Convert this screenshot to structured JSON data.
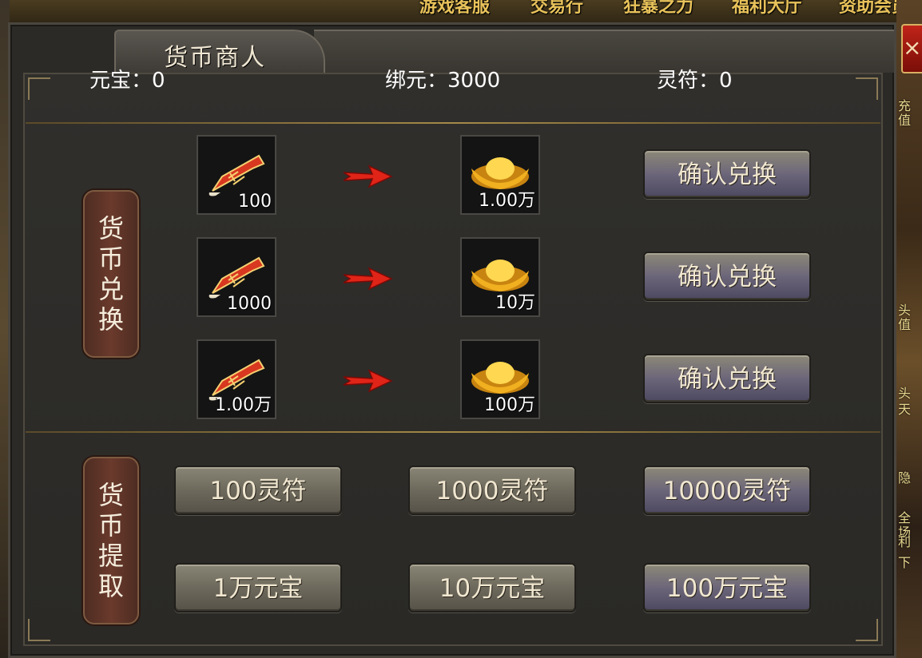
{
  "background": {
    "top_menu": [
      "游戏客服",
      "交易行",
      "狂暴之力",
      "福利大厅",
      "资助会员"
    ],
    "side_texts": [
      "充值",
      "头值",
      "头",
      "天",
      "隐",
      "全场",
      "利",
      "下"
    ]
  },
  "window": {
    "title": "货币商人",
    "close_label": "×"
  },
  "balances": [
    {
      "label": "元宝：",
      "value": "0"
    },
    {
      "label": "绑元：",
      "value": "3000"
    },
    {
      "label": "灵符：",
      "value": "0"
    }
  ],
  "exchange": {
    "section_label": "货币兑换",
    "rows": [
      {
        "from_icon": "talisman-scroll-icon",
        "from_amount": "100",
        "to_icon": "gold-ingot-icon",
        "to_amount": "1.00万",
        "button": "确认兑换"
      },
      {
        "from_icon": "talisman-scroll-icon",
        "from_amount": "1000",
        "to_icon": "gold-ingot-icon",
        "to_amount": "10万",
        "button": "确认兑换"
      },
      {
        "from_icon": "talisman-scroll-icon",
        "from_amount": "1.00万",
        "to_icon": "gold-ingot-icon",
        "to_amount": "100万",
        "button": "确认兑换"
      }
    ]
  },
  "withdraw": {
    "section_label": "货币提取",
    "row1": [
      "100灵符",
      "1000灵符",
      "10000灵符"
    ],
    "row2": [
      "1万元宝",
      "10万元宝",
      "100万元宝"
    ]
  },
  "colors": {
    "arrow": "#e02418",
    "ingot": "#f0b020",
    "scroll": "#d83820"
  }
}
